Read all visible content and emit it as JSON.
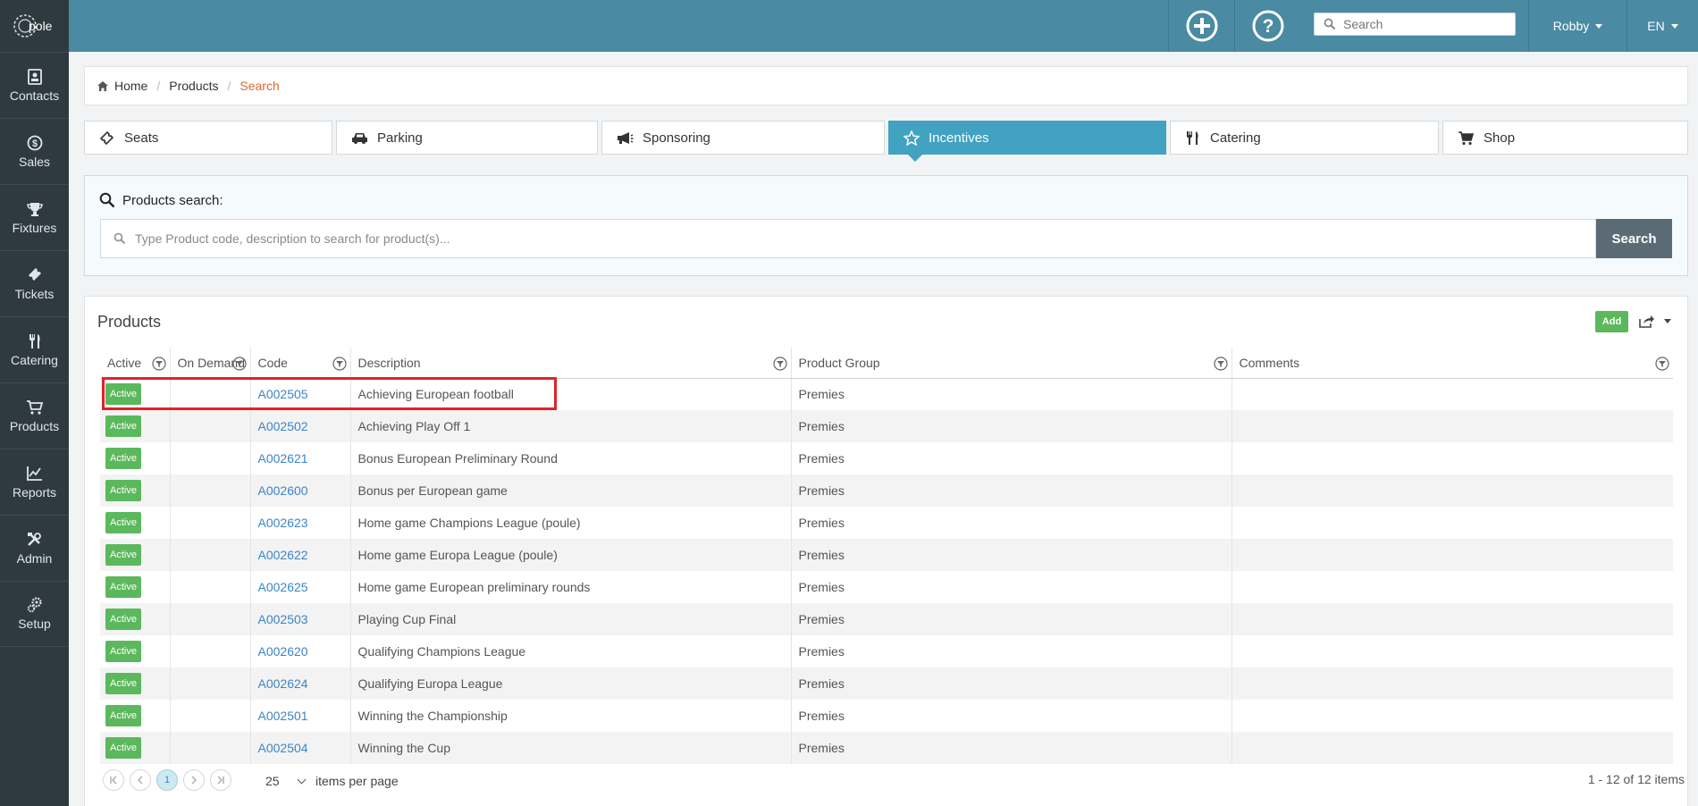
{
  "app": {
    "logo_text": "Xpole"
  },
  "sidebar": {
    "items": [
      {
        "label": "Contacts",
        "icon": "contacts-icon"
      },
      {
        "label": "Sales",
        "icon": "dollar-icon"
      },
      {
        "label": "Fixtures",
        "icon": "trophy-icon"
      },
      {
        "label": "Tickets",
        "icon": "ticket-icon"
      },
      {
        "label": "Catering",
        "icon": "cutlery-icon"
      },
      {
        "label": "Products",
        "icon": "cart-icon"
      },
      {
        "label": "Reports",
        "icon": "chart-icon"
      },
      {
        "label": "Admin",
        "icon": "tools-icon"
      },
      {
        "label": "Setup",
        "icon": "gears-icon"
      }
    ]
  },
  "topbar": {
    "search_placeholder": "Search",
    "user": "Robby",
    "language": "EN"
  },
  "breadcrumb": {
    "home": "Home",
    "products": "Products",
    "current": "Search"
  },
  "category_tabs": {
    "seats": "Seats",
    "parking": "Parking",
    "sponsoring": "Sponsoring",
    "incentives": "Incentives",
    "catering": "Catering",
    "shop": "Shop",
    "selected": "Incentives"
  },
  "search": {
    "title": "Products search:",
    "placeholder": "Type Product code, description to search for product(s)...",
    "button": "Search"
  },
  "products": {
    "title": "Products",
    "add_label": "Add",
    "columns": [
      "Active",
      "On Demand",
      "Code",
      "Description",
      "Product Group",
      "Comments"
    ],
    "rows": [
      {
        "status": "Active",
        "on_demand": "",
        "code": "A002505",
        "description": "Achieving European football",
        "group": "Premies",
        "comments": ""
      },
      {
        "status": "Active",
        "on_demand": "",
        "code": "A002502",
        "description": "Achieving Play Off 1",
        "group": "Premies",
        "comments": ""
      },
      {
        "status": "Active",
        "on_demand": "",
        "code": "A002621",
        "description": "Bonus European Preliminary Round",
        "group": "Premies",
        "comments": ""
      },
      {
        "status": "Active",
        "on_demand": "",
        "code": "A002600",
        "description": "Bonus per European game",
        "group": "Premies",
        "comments": ""
      },
      {
        "status": "Active",
        "on_demand": "",
        "code": "A002623",
        "description": "Home game Champions League (poule)",
        "group": "Premies",
        "comments": ""
      },
      {
        "status": "Active",
        "on_demand": "",
        "code": "A002622",
        "description": "Home game Europa League (poule)",
        "group": "Premies",
        "comments": ""
      },
      {
        "status": "Active",
        "on_demand": "",
        "code": "A002625",
        "description": "Home game European preliminary rounds",
        "group": "Premies",
        "comments": ""
      },
      {
        "status": "Active",
        "on_demand": "",
        "code": "A002503",
        "description": "Playing Cup Final",
        "group": "Premies",
        "comments": ""
      },
      {
        "status": "Active",
        "on_demand": "",
        "code": "A002620",
        "description": "Qualifying Champions League",
        "group": "Premies",
        "comments": ""
      },
      {
        "status": "Active",
        "on_demand": "",
        "code": "A002624",
        "description": "Qualifying Europa League",
        "group": "Premies",
        "comments": ""
      },
      {
        "status": "Active",
        "on_demand": "",
        "code": "A002501",
        "description": "Winning the Championship",
        "group": "Premies",
        "comments": ""
      },
      {
        "status": "Active",
        "on_demand": "",
        "code": "A002504",
        "description": "Winning the Cup",
        "group": "Premies",
        "comments": ""
      }
    ]
  },
  "pager": {
    "current_page": "1",
    "per_page": "25",
    "per_page_label": "items per page",
    "info": "1 - 12 of 12 items"
  },
  "colors": {
    "sidebar": "#2f3a40",
    "topbar": "#4a8aa3",
    "accent": "#42a2c1",
    "status_active": "#5cb85c",
    "highlight": "#e0232a"
  }
}
